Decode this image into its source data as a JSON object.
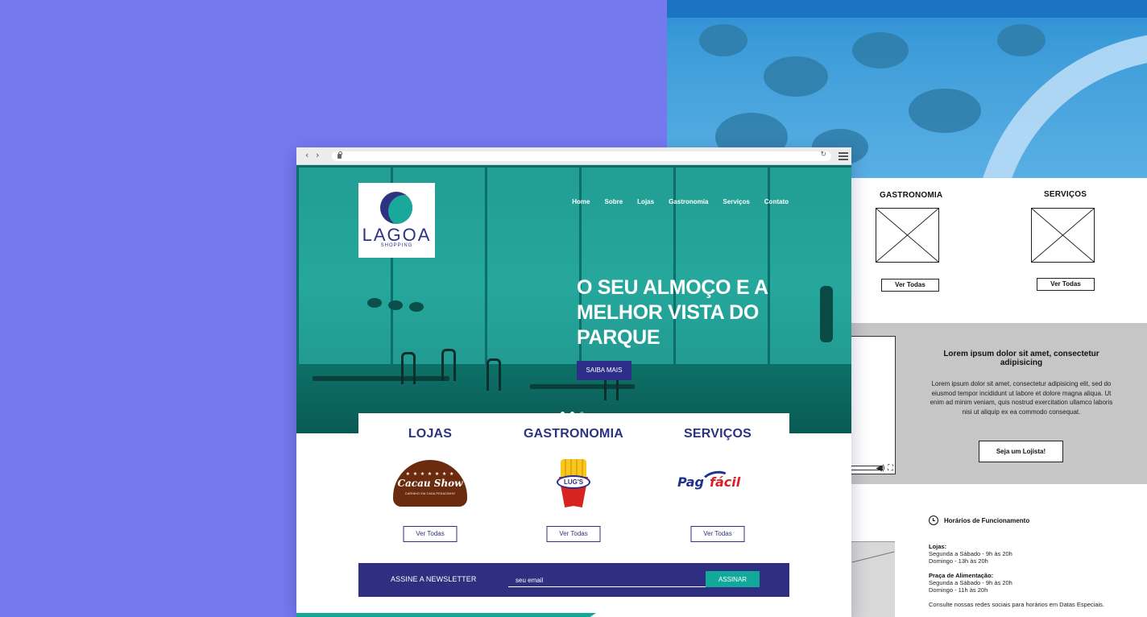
{
  "browser": {
    "back_glyph": "‹",
    "forward_glyph": "›",
    "reload_glyph": "↻",
    "icons": [
      "back-arrow-icon",
      "forward-arrow-icon",
      "lock-icon",
      "reload-icon",
      "hamburger-menu-icon"
    ]
  },
  "site": {
    "logo_word": "LAGOA",
    "logo_sub": "SHOPPING",
    "nav": [
      "Home",
      "Sobre",
      "Lojas",
      "Gastronomia",
      "Serviços",
      "Contato"
    ],
    "hero_title": "O SEU ALMOÇO E A MELHOR VISTA DO PARQUE",
    "hero_button": "SAIBA MAIS",
    "carousel": {
      "slides": 3,
      "active": 2
    },
    "categories": [
      {
        "title": "LOJAS",
        "brand": "Cacau Show",
        "button": "Ver Todas"
      },
      {
        "title": "GASTRONOMIA",
        "brand": "LUG'S",
        "button": "Ver Todas"
      },
      {
        "title": "SERVIÇOS",
        "brand": "Pag fácil",
        "button": "Ver Todas"
      }
    ],
    "cacau_stars": "★ ★ ★ ★ ★ ★ ★",
    "cacau_tag": "CARINHO EM CADA PEDACINHO",
    "pag_part1": "Pag",
    "pag_part2": "fácil",
    "newsletter": {
      "label": "ASSINE A NEWSLETTER",
      "placeholder": "seu email",
      "button": "ASSINAR"
    }
  },
  "wireframe": {
    "col1_title": "GASTRONOMIA",
    "col2_title": "SERVIÇOS",
    "col_button": "Ver Todas",
    "heading": "Lorem ipsum dolor sit amet, consectetur adipisicing",
    "paragraph": "Lorem ipsum dolor sit amet, consectetur adipisicing elit, sed do eiusmod tempor incididunt ut labore et dolore magna aliqua. Ut enim ad minim veniam, quis nostrud exercitation ullamco laboris nisi ut aliquip ex ea commodo consequat.",
    "cta": "Seja um Lojista!",
    "video_controls": "◀) ⛶",
    "hours": {
      "title": "Horários de Funcionamento",
      "groups": [
        {
          "label": "Lojas:",
          "lines": [
            "Segunda a Sábado - 9h às 20h",
            "Domingo - 13h às 20h"
          ]
        },
        {
          "label": "Praça de Alimentação:",
          "lines": [
            "Segunda a Sábado - 9h às 20h",
            "Domingo - 11h às 20h"
          ]
        }
      ],
      "note": "Consulte nossas redes sociais para horários em Datas Especiais."
    }
  },
  "colors": {
    "background": "#7479ee",
    "brand_navy": "#2d3282",
    "brand_teal": "#12a89a",
    "hero_teal": "#139d91"
  }
}
